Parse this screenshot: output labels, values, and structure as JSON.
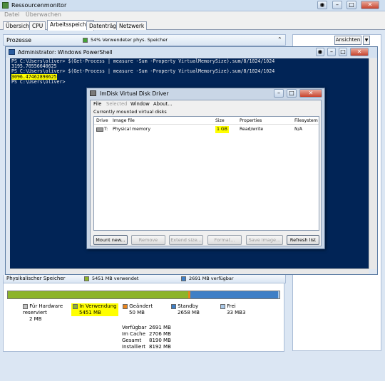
{
  "window": {
    "title": "Ressourcenmonitor"
  },
  "menu": [
    "Datei",
    "Überwachen"
  ],
  "tabs": [
    "Übersicht",
    "CPU",
    "Arbeitsspeicher",
    "Datenträger",
    "Netzwerk"
  ],
  "processes_bar": {
    "label": "Prozesse",
    "usage": "54% Verwendeter phys. Speicher"
  },
  "views_button": "Ansichten",
  "powershell": {
    "title": "Administrator: Windows PowerShell",
    "lines": [
      "PS C:\\Users\\oliver> $(Get-Process | measure -Sum -Property VirtualMemorySize).sum/8/1024/1024",
      "3195.70556640625",
      "PS C:\\Users\\oliver> $(Get-Process | measure -Sum -Property VirtualMemorySize).sum/8/1024/1024",
      "3096.47462890625",
      "PS C:\\Users\\oliver>"
    ]
  },
  "imdisk": {
    "title": "ImDisk Virtual Disk Driver",
    "menu": [
      "File",
      "Selected",
      "Window",
      "About..."
    ],
    "list_title": "Currently mounted virtual disks",
    "columns": [
      "Drive",
      "Image file",
      "Size",
      "Properties",
      "Filesystem"
    ],
    "row": {
      "drive": "T:",
      "image": "Physical memory",
      "size": "1 GB",
      "props": "Read/write",
      "fs": "N/A"
    },
    "buttons": [
      "Mount new...",
      "Remove",
      "Extend size...",
      "Format...",
      "Save image...",
      "Refresh list"
    ]
  },
  "physical_bar": {
    "label": "Physikalischer Speicher",
    "used": "5451 MB verwendet",
    "avail": "2691 MB verfügbar"
  },
  "memory": {
    "legend": [
      {
        "label": "Für Hardware reserviert",
        "value": "2 MB",
        "color": "#c0c0c0"
      },
      {
        "label": "In Verwendung",
        "value": "5451 MB",
        "color": "#8db42a"
      },
      {
        "label": "Geändert",
        "value": "50 MB",
        "color": "#e8851e"
      },
      {
        "label": "Standby",
        "value": "2658 MB",
        "color": "#3f7fc6"
      },
      {
        "label": "Frei",
        "value": "33 MB3",
        "color": "#a9c8e8"
      }
    ],
    "stats": [
      {
        "label": "Verfügbar",
        "value": "2691 MB"
      },
      {
        "label": "Im Cache",
        "value": "2706 MB"
      },
      {
        "label": "Gesamt",
        "value": "8190 MB"
      },
      {
        "label": "Installiert",
        "value": "8192 MB"
      }
    ],
    "bar_fractions": {
      "hardware": 0.0002,
      "in_use": 0.665,
      "modified": 0.006,
      "standby": 0.3245,
      "free": 0.004
    }
  }
}
